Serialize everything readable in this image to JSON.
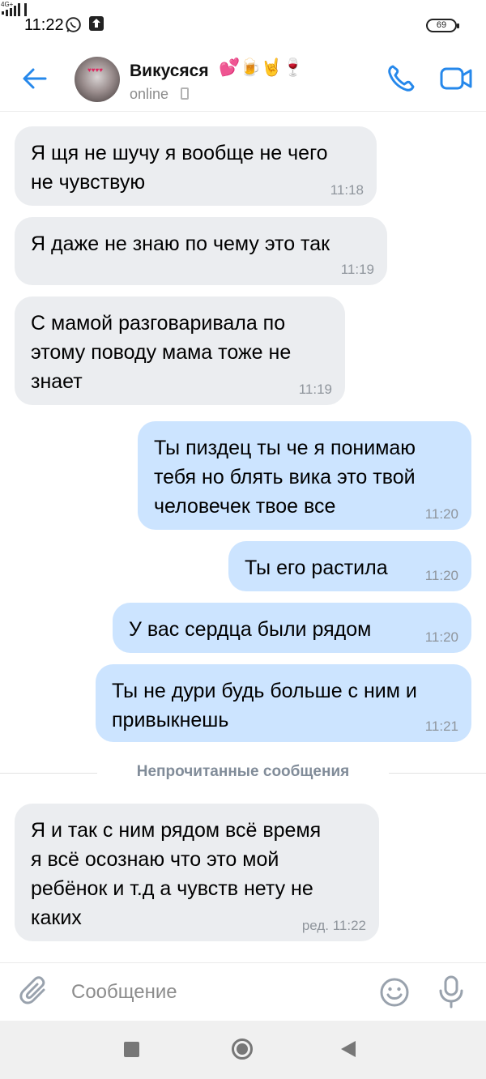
{
  "status_bar": {
    "time": "11:22",
    "network": "4G+",
    "battery": "69",
    "icons": [
      "whatsapp-icon",
      "upload-icon",
      "signal-icon",
      "battery-icon"
    ]
  },
  "header": {
    "contact_name": "Викусяся",
    "contact_emoji": "💕🍺🤘🍷",
    "status": "online",
    "icons": [
      "back-arrow-icon",
      "phone-icon",
      "video-camera-icon"
    ],
    "accent_color": "#2688eb"
  },
  "messages": [
    {
      "direction": "in",
      "text": "Я щя не шучу я вообще не чего\nне чувствую",
      "time": "11:18"
    },
    {
      "direction": "in",
      "text": "Я даже не знаю по чему это так",
      "time": "11:19"
    },
    {
      "direction": "in",
      "text": "С мамой разговаривала по\nэтому поводу мама тоже не\nзнает",
      "time": "11:19"
    },
    {
      "direction": "out",
      "text": "Ты пиздец ты че я понимаю\nтебя но блять вика это твой\nчеловечек твое все",
      "time": "11:20"
    },
    {
      "direction": "out",
      "text": "Ты его растила",
      "time": "11:20"
    },
    {
      "direction": "out",
      "text": "У вас сердца были рядом",
      "time": "11:20"
    },
    {
      "direction": "out",
      "text": "Ты не дури будь больше с ним и\nпривыкнешь",
      "time": "11:21"
    },
    {
      "direction": "in",
      "text": "Я и так с ним рядом всё время\nя всё осознаю что это мой\nребёнок и т.д а чувств нету не\nкаких",
      "time": "ред. 11:22"
    }
  ],
  "unread_separator": "Непрочитанные сообщения",
  "composer": {
    "placeholder": "Сообщение",
    "icons": [
      "paperclip-icon",
      "emoji-icon",
      "microphone-icon"
    ]
  },
  "colors": {
    "incoming_bubble": "#ebedf0",
    "outgoing_bubble": "#cce4ff",
    "timestamp": "#8f959c"
  }
}
